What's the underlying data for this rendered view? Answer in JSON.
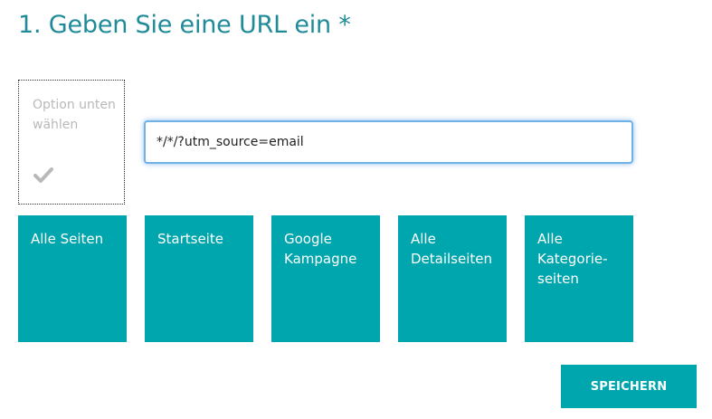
{
  "heading": "1. Geben Sie eine URL ein *",
  "option_card": {
    "text": "Option unten wählen",
    "icon": "check-icon"
  },
  "url_input": {
    "value": "*/*/?utm_source=email",
    "placeholder": ""
  },
  "tiles": [
    {
      "label": "Alle Seiten"
    },
    {
      "label": "Startseite"
    },
    {
      "label": "Google\nKampagne"
    },
    {
      "label": "Alle\nDetailseiten"
    },
    {
      "label": "Alle\nKategorie-\nseiten"
    }
  ],
  "save_button": "SPEICHERN",
  "colors": {
    "accent": "#00a6ad",
    "heading": "#1f8b99",
    "muted_text": "#b9b9b9",
    "input_focus": "#6fb2e6"
  }
}
